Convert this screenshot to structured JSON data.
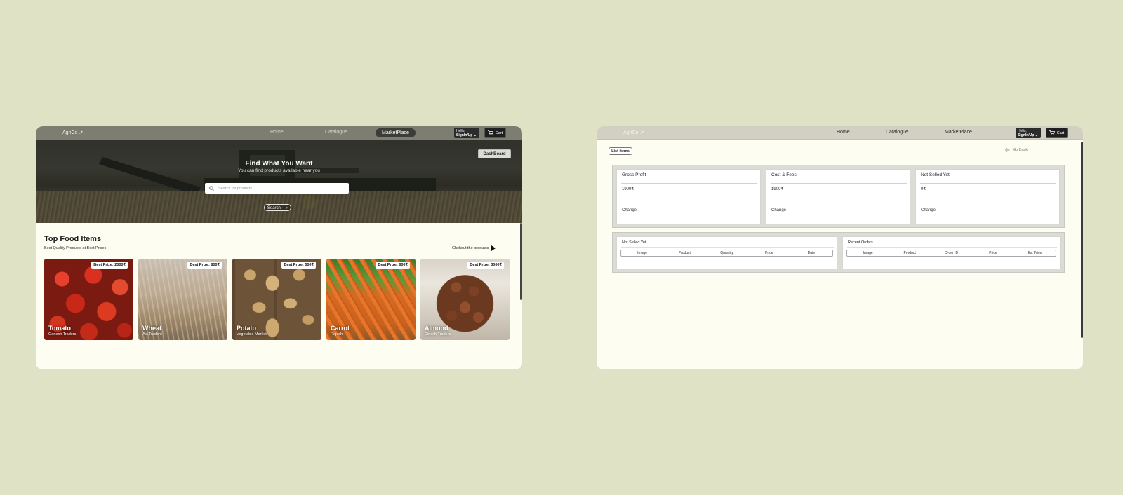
{
  "left": {
    "nav": {
      "logo": "AgriCo ↗",
      "links": [
        "Home",
        "Catalogue",
        "MarketPlace"
      ],
      "hello_line1": "Hello,",
      "hello_line2": "SignIn/Up ⌄",
      "cart": "Cart"
    },
    "hero": {
      "dashboard_btn": "DashBoard",
      "title": "Find What You Want",
      "subtitle": "You can find products available near you",
      "search_placeholder": "Search for products",
      "search_btn": "Search ⟶"
    },
    "products": {
      "title": "Top Food Items",
      "subtitle": "Best Quality Products at Best Prices",
      "checkout": "Chekout the products",
      "items": [
        {
          "name": "Tomato",
          "seller": "Ganesh Traders",
          "price": "Best Prize: 2000₹"
        },
        {
          "name": "Wheat",
          "seller": "Avi Traders",
          "price": "Best Prize: 800₹"
        },
        {
          "name": "Potato",
          "seller": "Vegetable Market",
          "price": "Best Prize: 500₹"
        },
        {
          "name": "Carrot",
          "seller": "Rajesh",
          "price": "Best Prize: 600₹"
        },
        {
          "name": "Almond",
          "seller": "Dinesh Traders",
          "price": "Best Prize: 3000₹"
        }
      ]
    }
  },
  "right": {
    "nav": {
      "logo": "AgriCo ↗",
      "links": [
        "Home",
        "Catalogue",
        "MarketPlace"
      ],
      "hello_line1": "Hello,",
      "hello_line2": "SignIn/Up ⌄",
      "cart": "Cart"
    },
    "list_items": "List Items",
    "go_back": "Go Back",
    "stats": [
      {
        "title": "Gross Profit",
        "value": "1900₹",
        "change": "Change"
      },
      {
        "title": "Cost & Fees",
        "value": "1900₹",
        "change": "Change"
      },
      {
        "title": "Not Selled Yet",
        "value": "0₹",
        "change": "Change"
      }
    ],
    "tables": [
      {
        "title": "Not Selled Yet",
        "columns": [
          "Image",
          "Product",
          "Quantity",
          "Price",
          "Date"
        ]
      },
      {
        "title": "Recent Orders",
        "columns": [
          "Image",
          "Product",
          "Order ID",
          "Price",
          "Est Price"
        ]
      }
    ]
  },
  "colors": {
    "background": "#e0e2c6",
    "window": "#fdfdf1",
    "nav_left": "#7e7d71",
    "nav_right": "#d1d0c2",
    "dark_button": "#2b2b2b"
  }
}
